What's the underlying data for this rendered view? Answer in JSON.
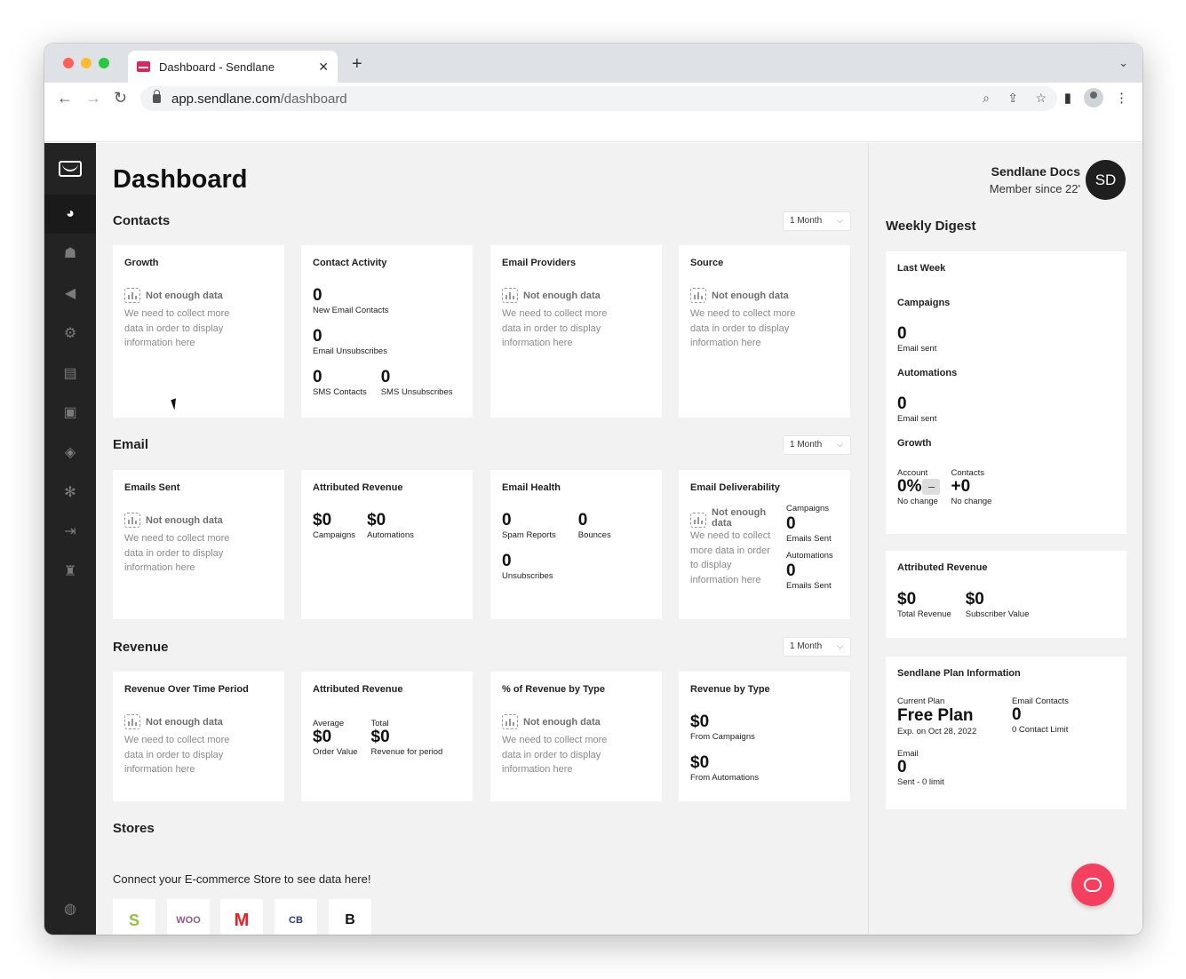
{
  "browser": {
    "tab_title": "Dashboard - Sendlane",
    "url_host": "app.sendlane.com",
    "url_path": "/dashboard"
  },
  "sidebar": {
    "items": [
      {
        "icon": "dashboard-icon",
        "active": true
      },
      {
        "icon": "contacts-icon"
      },
      {
        "icon": "campaigns-icon"
      },
      {
        "icon": "automations-icon"
      },
      {
        "icon": "sms-icon"
      },
      {
        "icon": "gallery-icon"
      },
      {
        "icon": "integrations-icon"
      },
      {
        "icon": "settings-icon"
      },
      {
        "icon": "logout-icon"
      },
      {
        "icon": "account-admin-icon"
      }
    ],
    "bottom_icon": "help-compass-icon"
  },
  "main": {
    "title": "Dashboard",
    "range_label": "1 Month",
    "not_enough": "Not enough data",
    "not_enough_desc": "We need to collect more data in order to display information here",
    "contacts": {
      "title": "Contacts",
      "growth": {
        "title": "Growth"
      },
      "activity": {
        "title": "Contact Activity",
        "new_email_value": "0",
        "new_email_label": "New Email Contacts",
        "unsub_value": "0",
        "unsub_label": "Email Unsubscribes",
        "sms_value": "0",
        "sms_label": "SMS Contacts",
        "sms_unsub_value": "0",
        "sms_unsub_label": "SMS Unsubscribes"
      },
      "providers": {
        "title": "Email Providers"
      },
      "source": {
        "title": "Source"
      }
    },
    "email": {
      "title": "Email",
      "sent": {
        "title": "Emails Sent"
      },
      "attributed": {
        "title": "Attributed Revenue",
        "campaigns_value": "$0",
        "campaigns_label": "Campaigns",
        "automations_value": "$0",
        "automations_label": "Automations"
      },
      "health": {
        "title": "Email Health",
        "spam_value": "0",
        "spam_label": "Spam Reports",
        "bounces_value": "0",
        "bounces_label": "Bounces",
        "unsub_value": "0",
        "unsub_label": "Unsubscribes"
      },
      "deliverability": {
        "title": "Email Deliverability",
        "nd_line1": "Not enough",
        "nd_line2": "data",
        "nd_desc": "We need to collect more data in order to display information here",
        "campaigns_label": "Campaigns",
        "campaigns_value": "0",
        "campaigns_sub": "Emails Sent",
        "automations_label": "Automations",
        "automations_value": "0",
        "automations_sub": "Emails Sent"
      }
    },
    "revenue": {
      "title": "Revenue",
      "over_time": {
        "title": "Revenue Over Time Period"
      },
      "attributed": {
        "title": "Attributed Revenue",
        "avg_label": "Average",
        "avg_value": "$0",
        "avg_sub": "Order Value",
        "total_label": "Total",
        "total_value": "$0",
        "total_sub": "Revenue for period"
      },
      "pct_type": {
        "title": "% of Revenue by Type"
      },
      "by_type": {
        "title": "Revenue by Type",
        "campaigns_value": "$0",
        "campaigns_label": "From Campaigns",
        "automations_value": "$0",
        "automations_label": "From Automations"
      }
    },
    "stores": {
      "title": "Stores",
      "subtitle": "Connect your E-commerce Store to see data here!",
      "logos": [
        {
          "icon": "shopify-logo",
          "text": "S",
          "color": "#95bf47"
        },
        {
          "icon": "woocommerce-logo",
          "text": "WOO",
          "color": "#96588a"
        },
        {
          "icon": "magento-logo",
          "text": "M",
          "color": "#ee1c25"
        },
        {
          "icon": "clickbank-logo",
          "text": "CB",
          "color": "#2b3a87"
        },
        {
          "icon": "bigcommerce-logo",
          "text": "B",
          "color": "#121118"
        }
      ]
    }
  },
  "right": {
    "user_name": "Sendlane Docs",
    "member_since": "Member since 22'",
    "avatar_initials": "SD",
    "digest_title": "Weekly Digest",
    "last_week": {
      "title": "Last Week",
      "campaigns_title": "Campaigns",
      "campaigns_value": "0",
      "campaigns_label": "Email sent",
      "automations_title": "Automations",
      "automations_value": "0",
      "automations_label": "Email sent",
      "growth_title": "Growth",
      "account_label": "Account",
      "account_value": "0%",
      "account_change": "No change",
      "contacts_label": "Contacts",
      "contacts_value": "+0",
      "contacts_change": "No change"
    },
    "attributed": {
      "title": "Attributed Revenue",
      "total_value": "$0",
      "total_label": "Total Revenue",
      "subscriber_value": "$0",
      "subscriber_label": "Subscriber Value"
    },
    "plan": {
      "title": "Sendlane Plan Information",
      "current_label": "Current Plan",
      "current_value": "Free Plan",
      "current_exp": "Exp. on Oct 28, 2022",
      "contacts_label": "Email Contacts",
      "contacts_value": "0",
      "contacts_limit": "0 Contact Limit",
      "email_label": "Email",
      "email_value": "0",
      "email_sub": "Sent - 0 limit"
    }
  },
  "colors": {
    "sidebar": "#232323",
    "fab": "#f43f5e",
    "background": "#f2f2f2"
  }
}
